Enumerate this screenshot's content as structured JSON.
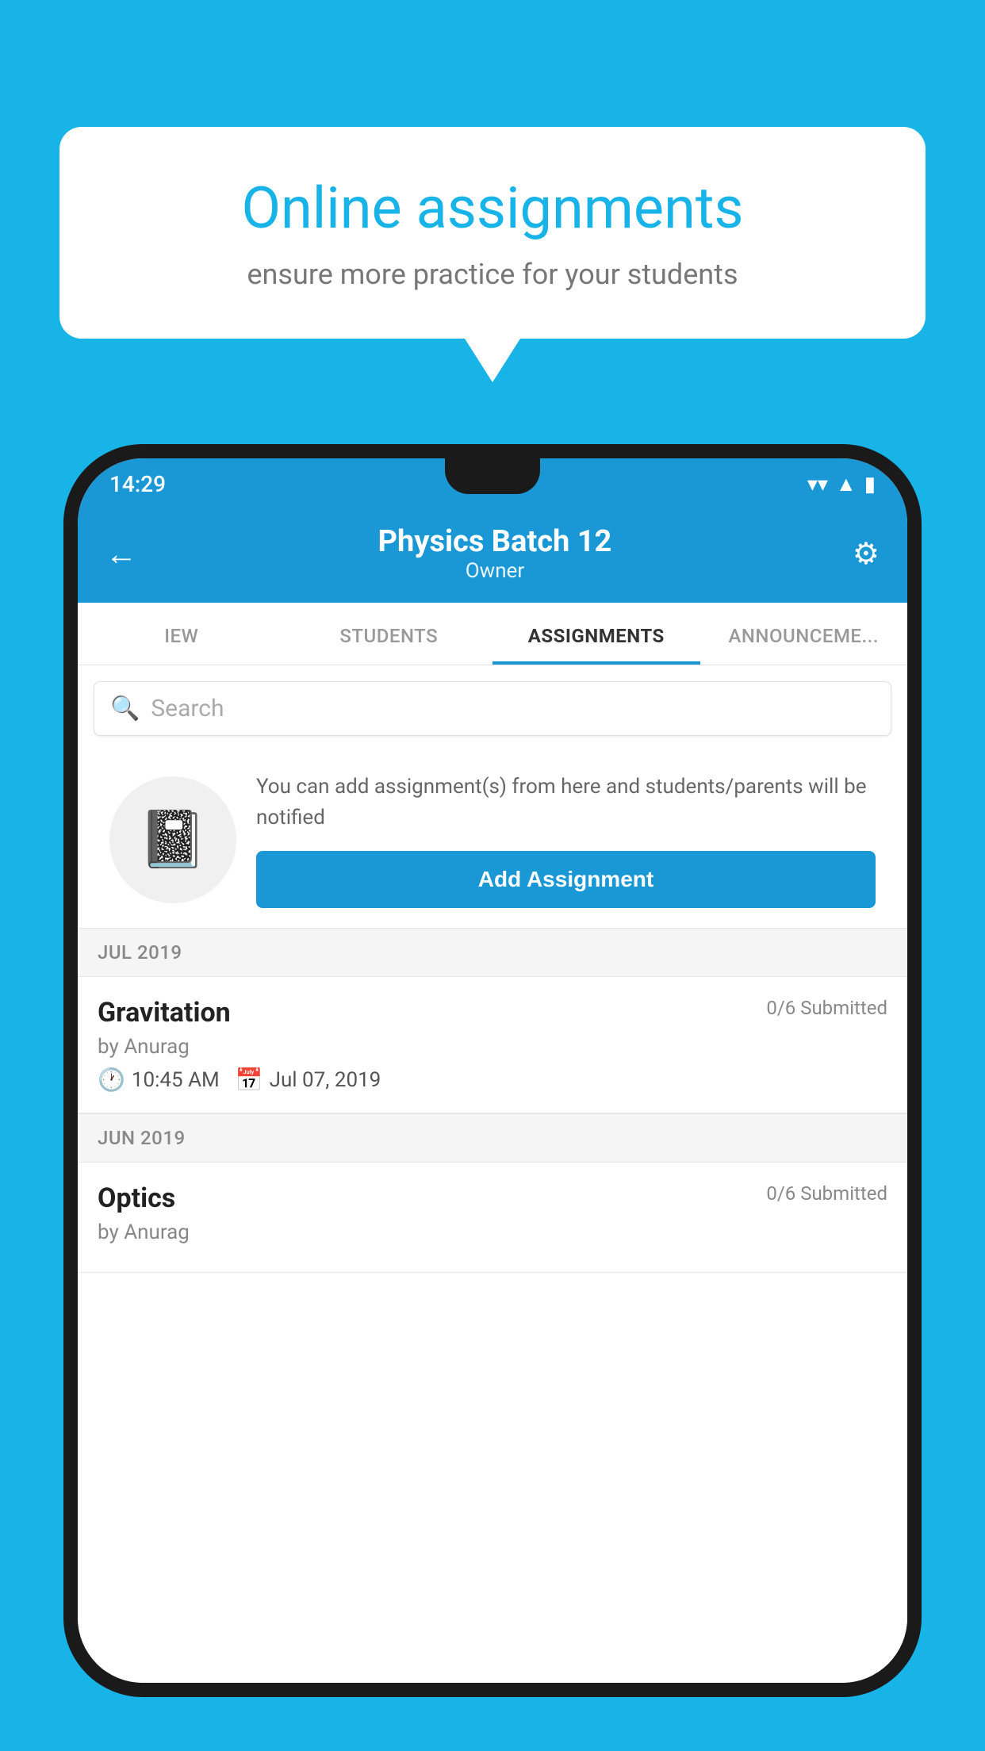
{
  "background_color": "#18b4e8",
  "speech_bubble": {
    "title": "Online assignments",
    "subtitle": "ensure more practice for your students"
  },
  "status_bar": {
    "time": "14:29",
    "wifi_icon": "▾",
    "signal_icon": "▲",
    "battery_icon": "▮"
  },
  "header": {
    "title": "Physics Batch 12",
    "subtitle": "Owner",
    "back_icon": "←",
    "settings_icon": "⚙"
  },
  "tabs": [
    {
      "label": "IEW",
      "active": false
    },
    {
      "label": "STUDENTS",
      "active": false
    },
    {
      "label": "ASSIGNMENTS",
      "active": true
    },
    {
      "label": "ANNOUNCEMENTS",
      "active": false
    }
  ],
  "search": {
    "placeholder": "Search"
  },
  "promo": {
    "description": "You can add assignment(s) from here and students/parents will be notified",
    "add_button_label": "Add Assignment"
  },
  "sections": [
    {
      "label": "JUL 2019",
      "assignments": [
        {
          "name": "Gravitation",
          "submitted": "0/6 Submitted",
          "author": "by Anurag",
          "time": "10:45 AM",
          "date": "Jul 07, 2019"
        }
      ]
    },
    {
      "label": "JUN 2019",
      "assignments": [
        {
          "name": "Optics",
          "submitted": "0/6 Submitted",
          "author": "by Anurag",
          "time": "",
          "date": ""
        }
      ]
    }
  ]
}
